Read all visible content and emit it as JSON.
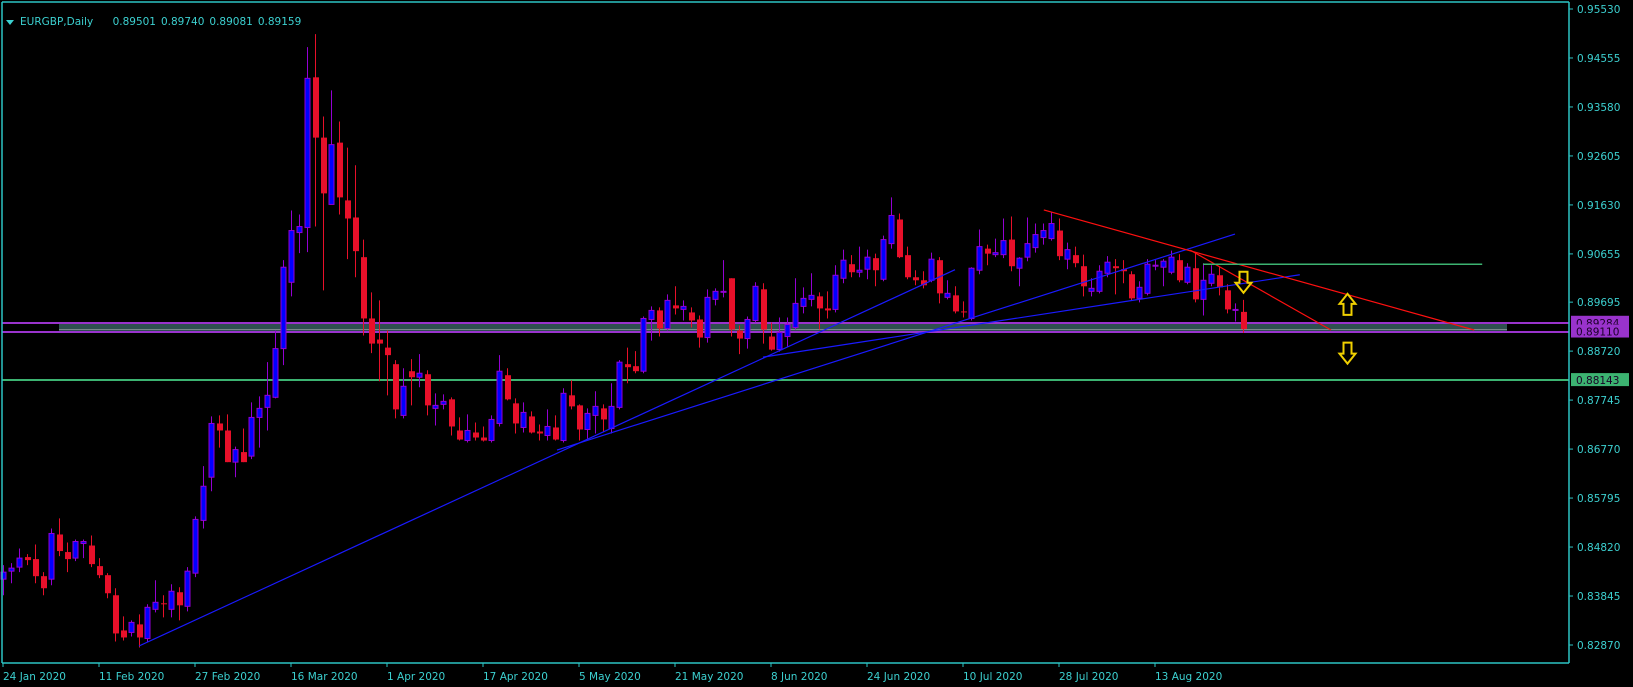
{
  "header": {
    "symbol_timeframe": "EURGBP,Daily",
    "open": "0.89501",
    "high": "0.89740",
    "low": "0.89081",
    "close": "0.89159",
    "collapse_icon": "triangle-down-icon"
  },
  "colors": {
    "background": "#000000",
    "frame": "#2cc4c4",
    "axis_text": "#3cd0d0",
    "bull_body": "#0000ff",
    "bull_outline": "#9400d3",
    "bear_body": "#e8102a",
    "trendline_blue": "#1a1aff",
    "trendline_red": "#ff1010",
    "level_purple": "#9933cc",
    "level_green": "#3cb371",
    "zone_fill": "#2f5050",
    "arrow_yellow": "#f0d000"
  },
  "chart_data": {
    "type": "candlestick",
    "title": "EURGBP,Daily",
    "ylim": [
      0.8287,
      0.9553
    ],
    "grid": false,
    "y_ticks": [
      "0.95530",
      "0.94555",
      "0.93580",
      "0.92605",
      "0.91630",
      "0.90655",
      "0.89695",
      "0.88720",
      "0.87745",
      "0.86770",
      "0.85795",
      "0.84820",
      "0.83845",
      "0.82870"
    ],
    "x_ticks": [
      {
        "bar": 0,
        "label": "24 Jan 2020"
      },
      {
        "bar": 12,
        "label": "11 Feb 2020"
      },
      {
        "bar": 24,
        "label": "27 Feb 2020"
      },
      {
        "bar": 36,
        "label": "16 Mar 2020"
      },
      {
        "bar": 48,
        "label": "1 Apr 2020"
      },
      {
        "bar": 60,
        "label": "17 Apr 2020"
      },
      {
        "bar": 72,
        "label": "5 May 2020"
      },
      {
        "bar": 84,
        "label": "21 May 2020"
      },
      {
        "bar": 96,
        "label": "8 Jun 2020"
      },
      {
        "bar": 108,
        "label": "24 Jun 2020"
      },
      {
        "bar": 120,
        "label": "10 Jul 2020"
      },
      {
        "bar": 132,
        "label": "28 Jul 2020"
      },
      {
        "bar": 144,
        "label": "13 Aug 2020"
      }
    ],
    "candle_fields": [
      "open",
      "high",
      "low",
      "close"
    ],
    "candles": [
      [
        0.8418,
        0.8446,
        0.8386,
        0.8432
      ],
      [
        0.8434,
        0.845,
        0.841,
        0.844
      ],
      [
        0.8442,
        0.8479,
        0.8432,
        0.846
      ],
      [
        0.8462,
        0.8468,
        0.8446,
        0.8456
      ],
      [
        0.8458,
        0.8487,
        0.841,
        0.8424
      ],
      [
        0.8424,
        0.8432,
        0.8386,
        0.84
      ],
      [
        0.8418,
        0.8519,
        0.8406,
        0.8509
      ],
      [
        0.8507,
        0.8539,
        0.8464,
        0.8474
      ],
      [
        0.8472,
        0.8491,
        0.8432,
        0.8458
      ],
      [
        0.846,
        0.8497,
        0.8454,
        0.8493
      ],
      [
        0.8489,
        0.8497,
        0.846,
        0.8493
      ],
      [
        0.8485,
        0.8505,
        0.8442,
        0.8448
      ],
      [
        0.8444,
        0.846,
        0.842,
        0.8426
      ],
      [
        0.8426,
        0.843,
        0.838,
        0.839
      ],
      [
        0.8386,
        0.84,
        0.8294,
        0.831
      ],
      [
        0.8316,
        0.8344,
        0.8296,
        0.8302
      ],
      [
        0.8312,
        0.8336,
        0.8304,
        0.8332
      ],
      [
        0.8328,
        0.8348,
        0.8282,
        0.8302
      ],
      [
        0.83,
        0.8368,
        0.8292,
        0.8362
      ],
      [
        0.8358,
        0.8416,
        0.8352,
        0.8372
      ],
      [
        0.837,
        0.8386,
        0.8342,
        0.8368
      ],
      [
        0.8358,
        0.8408,
        0.8342,
        0.8394
      ],
      [
        0.8392,
        0.8402,
        0.8336,
        0.8366
      ],
      [
        0.8364,
        0.8442,
        0.8354,
        0.8434
      ],
      [
        0.843,
        0.8543,
        0.8422,
        0.8537
      ],
      [
        0.8535,
        0.8643,
        0.8519,
        0.8603
      ],
      [
        0.8621,
        0.8742,
        0.8593,
        0.8728
      ],
      [
        0.8728,
        0.8744,
        0.868,
        0.8714
      ],
      [
        0.8714,
        0.8746,
        0.8651,
        0.8651
      ],
      [
        0.8651,
        0.8682,
        0.8621,
        0.8676
      ],
      [
        0.8671,
        0.8718,
        0.8651,
        0.8651
      ],
      [
        0.8663,
        0.877,
        0.8657,
        0.874
      ],
      [
        0.874,
        0.8782,
        0.868,
        0.8758
      ],
      [
        0.876,
        0.885,
        0.8714,
        0.8784
      ],
      [
        0.878,
        0.8913,
        0.8778,
        0.8877
      ],
      [
        0.8877,
        0.9053,
        0.8844,
        0.9039
      ],
      [
        0.9009,
        0.9152,
        0.8981,
        0.9112
      ],
      [
        0.9108,
        0.9144,
        0.9067,
        0.912
      ],
      [
        0.9118,
        0.9477,
        0.9069,
        0.9415
      ],
      [
        0.9417,
        0.9503,
        0.912,
        0.9297
      ],
      [
        0.9297,
        0.9339,
        0.8993,
        0.9186
      ],
      [
        0.9164,
        0.9391,
        0.9164,
        0.9283
      ],
      [
        0.9287,
        0.9329,
        0.9144,
        0.9178
      ],
      [
        0.9172,
        0.9277,
        0.9055,
        0.9136
      ],
      [
        0.9138,
        0.9242,
        0.9019,
        0.9071
      ],
      [
        0.9059,
        0.9094,
        0.8903,
        0.8937
      ],
      [
        0.8937,
        0.8989,
        0.8868,
        0.8887
      ],
      [
        0.8895,
        0.8973,
        0.8812,
        0.8887
      ],
      [
        0.8879,
        0.8913,
        0.8784,
        0.8864
      ],
      [
        0.8846,
        0.8854,
        0.8738,
        0.8756
      ],
      [
        0.8744,
        0.8838,
        0.8738,
        0.8802
      ],
      [
        0.8832,
        0.8856,
        0.8764,
        0.882
      ],
      [
        0.882,
        0.8866,
        0.88,
        0.8828
      ],
      [
        0.8826,
        0.8834,
        0.8744,
        0.8764
      ],
      [
        0.8758,
        0.8788,
        0.8724,
        0.8764
      ],
      [
        0.8766,
        0.8786,
        0.8756,
        0.8772
      ],
      [
        0.8776,
        0.878,
        0.8704,
        0.8722
      ],
      [
        0.8714,
        0.874,
        0.8694,
        0.8696
      ],
      [
        0.8694,
        0.8746,
        0.869,
        0.8714
      ],
      [
        0.871,
        0.873,
        0.8694,
        0.87
      ],
      [
        0.87,
        0.8722,
        0.8692,
        0.8694
      ],
      [
        0.8694,
        0.8744,
        0.869,
        0.8736
      ],
      [
        0.8728,
        0.8864,
        0.8722,
        0.8832
      ],
      [
        0.8824,
        0.8838,
        0.8774,
        0.8776
      ],
      [
        0.8768,
        0.8778,
        0.8708,
        0.8728
      ],
      [
        0.872,
        0.877,
        0.871,
        0.875
      ],
      [
        0.8742,
        0.8752,
        0.8708,
        0.871
      ],
      [
        0.8712,
        0.8726,
        0.8694,
        0.8708
      ],
      [
        0.8704,
        0.8756,
        0.8694,
        0.8722
      ],
      [
        0.872,
        0.8744,
        0.8694,
        0.8696
      ],
      [
        0.8694,
        0.8798,
        0.869,
        0.8788
      ],
      [
        0.8784,
        0.8814,
        0.8756,
        0.8762
      ],
      [
        0.8764,
        0.8766,
        0.8694,
        0.8716
      ],
      [
        0.8716,
        0.8758,
        0.8698,
        0.8748
      ],
      [
        0.8744,
        0.8792,
        0.8708,
        0.8762
      ],
      [
        0.8758,
        0.8766,
        0.8712,
        0.8736
      ],
      [
        0.8718,
        0.8808,
        0.8708,
        0.8762
      ],
      [
        0.876,
        0.8854,
        0.8756,
        0.885
      ],
      [
        0.8846,
        0.8879,
        0.8808,
        0.884
      ],
      [
        0.8842,
        0.8872,
        0.8828,
        0.8832
      ],
      [
        0.8832,
        0.8941,
        0.8828,
        0.8937
      ],
      [
        0.8935,
        0.8961,
        0.8893,
        0.8953
      ],
      [
        0.8953,
        0.8959,
        0.8901,
        0.8917
      ],
      [
        0.8917,
        0.8985,
        0.8913,
        0.8973
      ],
      [
        0.8963,
        0.9001,
        0.8945,
        0.8957
      ],
      [
        0.8955,
        0.8973,
        0.8933,
        0.8961
      ],
      [
        0.8949,
        0.8959,
        0.8919,
        0.8933
      ],
      [
        0.8935,
        0.8943,
        0.8879,
        0.8899
      ],
      [
        0.8899,
        0.8995,
        0.8889,
        0.8979
      ],
      [
        0.8975,
        0.8997,
        0.8963,
        0.8991
      ],
      [
        0.8989,
        0.9053,
        0.8979,
        0.8991
      ],
      [
        0.9017,
        0.9017,
        0.8901,
        0.8915
      ],
      [
        0.8913,
        0.8923,
        0.8866,
        0.8897
      ],
      [
        0.8897,
        0.8941,
        0.8877,
        0.8935
      ],
      [
        0.8933,
        0.9009,
        0.8929,
        0.9001
      ],
      [
        0.8995,
        0.9007,
        0.8887,
        0.8915
      ],
      [
        0.8901,
        0.8929,
        0.8873,
        0.8875
      ],
      [
        0.8875,
        0.8939,
        0.8871,
        0.8909
      ],
      [
        0.8901,
        0.8939,
        0.8881,
        0.8925
      ],
      [
        0.8919,
        0.9017,
        0.8915,
        0.8967
      ],
      [
        0.8961,
        0.8999,
        0.8947,
        0.8977
      ],
      [
        0.8975,
        0.9027,
        0.8961,
        0.8983
      ],
      [
        0.8981,
        0.8989,
        0.8915,
        0.8957
      ],
      [
        0.8957,
        0.8991,
        0.8937,
        0.8953
      ],
      [
        0.8955,
        0.9043,
        0.8949,
        0.9023
      ],
      [
        0.9017,
        0.9074,
        0.9007,
        0.9053
      ],
      [
        0.9045,
        0.9063,
        0.9019,
        0.9029
      ],
      [
        0.9029,
        0.908,
        0.9019,
        0.9033
      ],
      [
        0.9035,
        0.9074,
        0.9015,
        0.9059
      ],
      [
        0.9057,
        0.9066,
        0.9001,
        0.9033
      ],
      [
        0.9015,
        0.9102,
        0.9011,
        0.9094
      ],
      [
        0.9086,
        0.9178,
        0.9076,
        0.9142
      ],
      [
        0.9134,
        0.9146,
        0.9057,
        0.9059
      ],
      [
        0.9063,
        0.908,
        0.9015,
        0.9019
      ],
      [
        0.9019,
        0.9033,
        0.9003,
        0.9013
      ],
      [
        0.9013,
        0.9031,
        0.8997,
        0.9003
      ],
      [
        0.9013,
        0.9068,
        0.9009,
        0.9055
      ],
      [
        0.9053,
        0.9059,
        0.8967,
        0.8987
      ],
      [
        0.8979,
        0.9013,
        0.8975,
        0.8987
      ],
      [
        0.8983,
        0.9001,
        0.8947,
        0.8951
      ],
      [
        0.8951,
        0.8971,
        0.8939,
        0.8949
      ],
      [
        0.8937,
        0.9039,
        0.8933,
        0.9037
      ],
      [
        0.9033,
        0.9114,
        0.9025,
        0.908
      ],
      [
        0.9076,
        0.9084,
        0.9043,
        0.9066
      ],
      [
        0.9064,
        0.9096,
        0.9059,
        0.9068
      ],
      [
        0.9064,
        0.9136,
        0.9057,
        0.9092
      ],
      [
        0.9094,
        0.914,
        0.9031,
        0.9041
      ],
      [
        0.9037,
        0.9059,
        0.9001,
        0.9057
      ],
      [
        0.9059,
        0.9138,
        0.9051,
        0.9086
      ],
      [
        0.9078,
        0.9126,
        0.9068,
        0.9104
      ],
      [
        0.9098,
        0.9126,
        0.9084,
        0.9112
      ],
      [
        0.9096,
        0.9148,
        0.9092,
        0.9126
      ],
      [
        0.9112,
        0.9136,
        0.9053,
        0.9061
      ],
      [
        0.9055,
        0.9088,
        0.9035,
        0.9074
      ],
      [
        0.9063,
        0.908,
        0.9039,
        0.9047
      ],
      [
        0.9041,
        0.9064,
        0.8981,
        0.9001
      ],
      [
        0.8991,
        0.9017,
        0.8981,
        0.8997
      ],
      [
        0.8991,
        0.9043,
        0.8987,
        0.9031
      ],
      [
        0.9027,
        0.9061,
        0.9019,
        0.9049
      ],
      [
        0.9041,
        0.9055,
        0.8985,
        0.9037
      ],
      [
        0.9035,
        0.9053,
        0.9007,
        0.9031
      ],
      [
        0.9025,
        0.9031,
        0.8973,
        0.8977
      ],
      [
        0.8977,
        0.9011,
        0.8969,
        0.8999
      ],
      [
        0.8987,
        0.9055,
        0.8983,
        0.9045
      ],
      [
        0.9041,
        0.9053,
        0.9033,
        0.9043
      ],
      [
        0.9039,
        0.9055,
        0.9001,
        0.9051
      ],
      [
        0.9029,
        0.9072,
        0.9025,
        0.9059
      ],
      [
        0.9053,
        0.9065,
        0.9009,
        0.9013
      ],
      [
        0.9009,
        0.9047,
        0.9005,
        0.9039
      ],
      [
        0.9037,
        0.9069,
        0.8969,
        0.8975
      ],
      [
        0.8975,
        0.9047,
        0.8943,
        0.9013
      ],
      [
        0.9007,
        0.9043,
        0.9001,
        0.9025
      ],
      [
        0.9023,
        0.9039,
        0.8983,
        0.8999
      ],
      [
        0.8993,
        0.9005,
        0.8947,
        0.8955
      ],
      [
        0.8953,
        0.8967,
        0.8931,
        0.8955
      ],
      [
        0.89501,
        0.8974,
        0.89081,
        0.89159
      ]
    ],
    "trendlines": [
      {
        "name": "blue-trendline-1",
        "color": "blue",
        "from": [
          17,
          0.8285
        ],
        "to": [
          119,
          0.9034
        ]
      },
      {
        "name": "blue-trendline-2",
        "color": "blue",
        "from": [
          69.25,
          0.8675
        ],
        "to": [
          154,
          0.9105
        ]
      },
      {
        "name": "blue-trendline-3",
        "color": "blue",
        "from": [
          95,
          0.886
        ],
        "to": [
          162.1,
          0.9024
        ]
      },
      {
        "name": "red-trendline-1",
        "color": "red",
        "from": [
          130.1,
          0.9153
        ],
        "to": [
          183.9,
          0.8914
        ]
      },
      {
        "name": "red-trendline-2",
        "color": "red",
        "from": [
          148.4,
          0.9073
        ],
        "to": [
          166,
          0.8914
        ]
      },
      {
        "name": "green-short-level",
        "color": "green",
        "from": [
          150,
          0.9045
        ],
        "to": [
          184.9,
          0.9045
        ]
      }
    ],
    "horizontal_levels": [
      {
        "name": "purple-level-upper",
        "price": 0.89284,
        "label": "0.89284",
        "color": "purple"
      },
      {
        "name": "purple-level-lower",
        "price": 0.8911,
        "label": "0.89110",
        "color": "purple"
      },
      {
        "name": "green-level",
        "price": 0.88143,
        "label": "0.88143",
        "color": "green"
      }
    ],
    "zone": {
      "from_bar": 7,
      "to_bar": 188,
      "top": 0.89284,
      "bottom": 0.8911
    },
    "arrows": [
      {
        "name": "down-arrow-1",
        "direction": "down",
        "bar": 155,
        "price": 0.9008
      },
      {
        "name": "up-arrow",
        "direction": "up",
        "bar": 168,
        "price": 0.8966
      },
      {
        "name": "down-arrow-2",
        "direction": "down",
        "bar": 168,
        "price": 0.8867
      }
    ]
  }
}
